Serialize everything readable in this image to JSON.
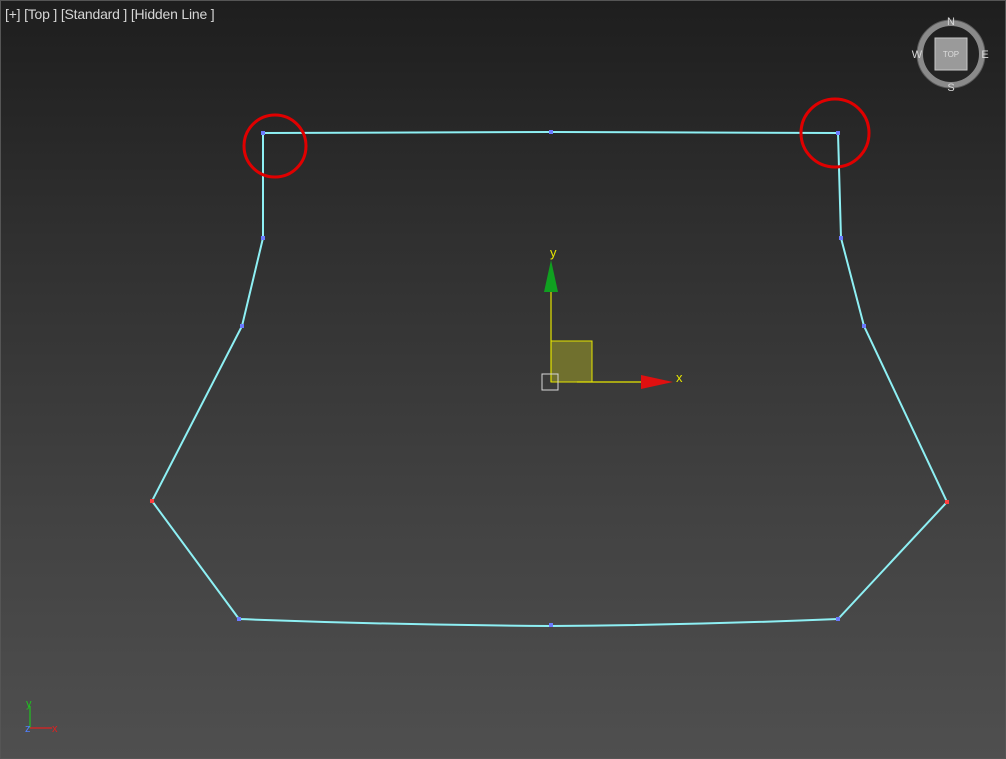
{
  "viewport": {
    "labels": {
      "menu": "[+]",
      "view": "[Top ]",
      "shading": "[Standard ]",
      "style": "[Hidden Line ]"
    }
  },
  "gizmo": {
    "x_label": "x",
    "y_label": "y"
  },
  "viewcube": {
    "face": "TOP",
    "north": "N",
    "south": "S",
    "east": "E",
    "west": "W"
  },
  "world_axes": {
    "x": "x",
    "y": "y",
    "z": "z"
  },
  "colors": {
    "spline": "#8ef0f4",
    "vertex": "#6b7bff",
    "highlight_circle": "#e00000",
    "gizmo_x": "#e01010",
    "gizmo_y": "#10a020",
    "gizmo_axis_line": "#e6e600"
  }
}
